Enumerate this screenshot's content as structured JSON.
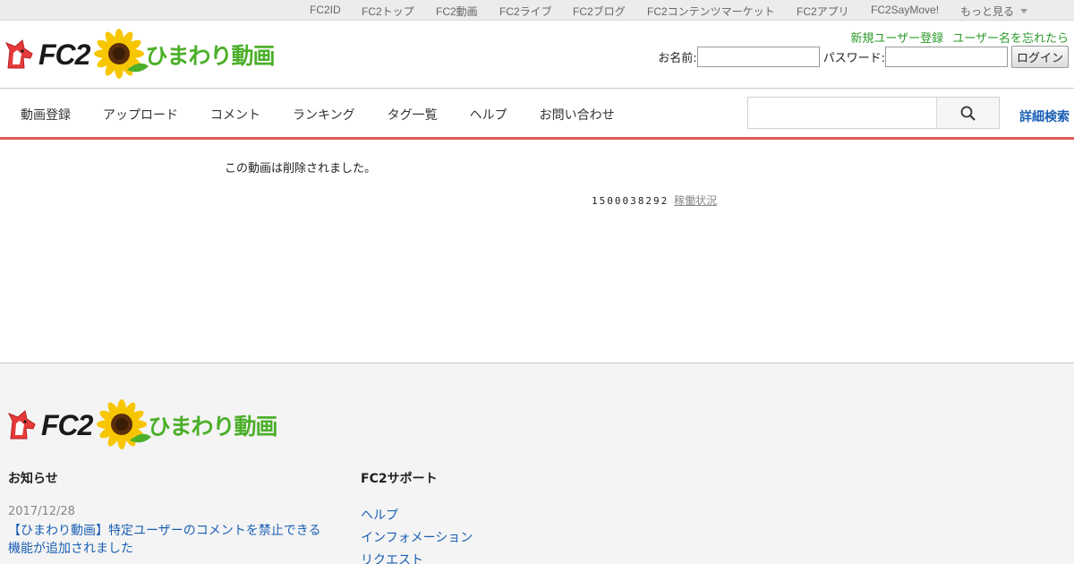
{
  "topbar": {
    "links": [
      "FC2ID",
      "FC2トップ",
      "FC2動画",
      "FC2ライブ",
      "FC2ブログ",
      "FC2コンテンツマーケット",
      "FC2アプリ",
      "FC2SayMove!",
      "もっと見る"
    ]
  },
  "header": {
    "brand": "FC2",
    "site_name": "ひまわり動画",
    "register_link": "新規ユーザー登録",
    "forgot_link": "ユーザー名を忘れたら",
    "name_label": "お名前:",
    "password_label": "パスワード:",
    "login_button": "ログイン"
  },
  "nav": {
    "items": [
      "動画登録",
      "アップロード",
      "コメント",
      "ランキング",
      "タグ一覧",
      "ヘルプ",
      "お問い合わせ"
    ],
    "search_placeholder": "",
    "detail_search": "詳細検索"
  },
  "main": {
    "deleted_message": "この動画は削除されました。",
    "status_number": "1500038292",
    "status_link": "稼働状況"
  },
  "footer": {
    "brand": "FC2",
    "site_name": "ひまわり動画",
    "news_title": "お知らせ",
    "news_date": "2017/12/28",
    "news_text": "【ひまわり動画】特定ユーザーのコメントを禁止できる機能が追加されました",
    "support_title": "FC2サポート",
    "support_links": [
      "ヘルプ",
      "インフォメーション",
      "リクエスト"
    ]
  },
  "colors": {
    "accent_red": "#de5a5a",
    "link_blue": "#1a5fb4",
    "register_green": "#2a9a2a",
    "brand_green": "#4caf2a"
  }
}
